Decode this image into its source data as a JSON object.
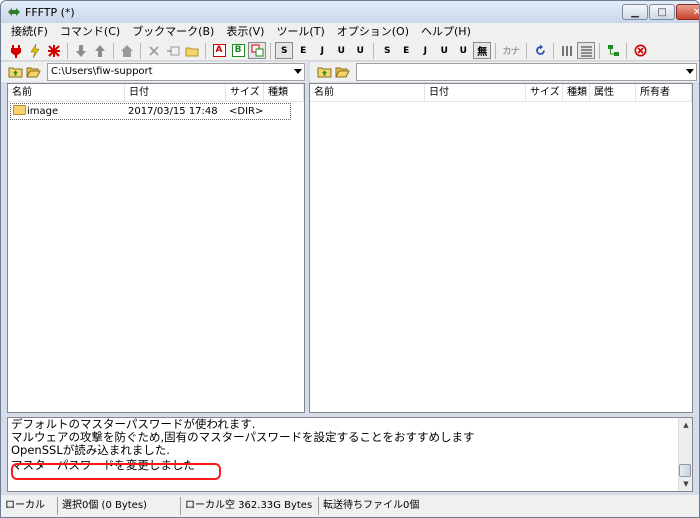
{
  "window": {
    "title": "FFFTP (*)"
  },
  "menu": [
    {
      "label": "接続(F)"
    },
    {
      "label": "コマンド(C)"
    },
    {
      "label": "ブックマーク(B)"
    },
    {
      "label": "表示(V)"
    },
    {
      "label": "ツール(T)"
    },
    {
      "label": "オプション(O)"
    },
    {
      "label": "ヘルプ(H)"
    }
  ],
  "toolbar": {
    "text_buttons": {
      "ascii": "A",
      "binary": "B",
      "sjis": "S",
      "euc": "E",
      "jis": "J",
      "utf8": "U",
      "utf8bom": "U",
      "kana": "カナ",
      "nochange": "無"
    }
  },
  "local": {
    "path": "C:\\Users\\fiw-support",
    "columns": [
      "名前",
      "日付",
      "サイズ",
      "種類"
    ],
    "rows": [
      {
        "name": "image",
        "date": "2017/03/15 17:48",
        "size": "<DIR>",
        "type": ""
      }
    ]
  },
  "remote": {
    "path": "",
    "columns": [
      "名前",
      "日付",
      "サイズ",
      "種類",
      "属性",
      "所有者"
    ]
  },
  "log": {
    "lines": [
      "デフォルトのマスターパスワードが使われます.",
      "マルウェアの攻撃を防ぐため,固有のマスターパスワードを設定することをおすすめします",
      "OpenSSLが読み込まれました.",
      "マスターパスワードを変更しました"
    ]
  },
  "status": {
    "local": "ローカル",
    "selection": "選択0個 (0 Bytes)",
    "free_space": "ローカル空 362.33G Bytes",
    "queue": "転送待ちファイル0個"
  },
  "colors": {
    "highlight": "#ff1a1a",
    "disconnect": "#d40000",
    "green": "#1f8a1f"
  }
}
